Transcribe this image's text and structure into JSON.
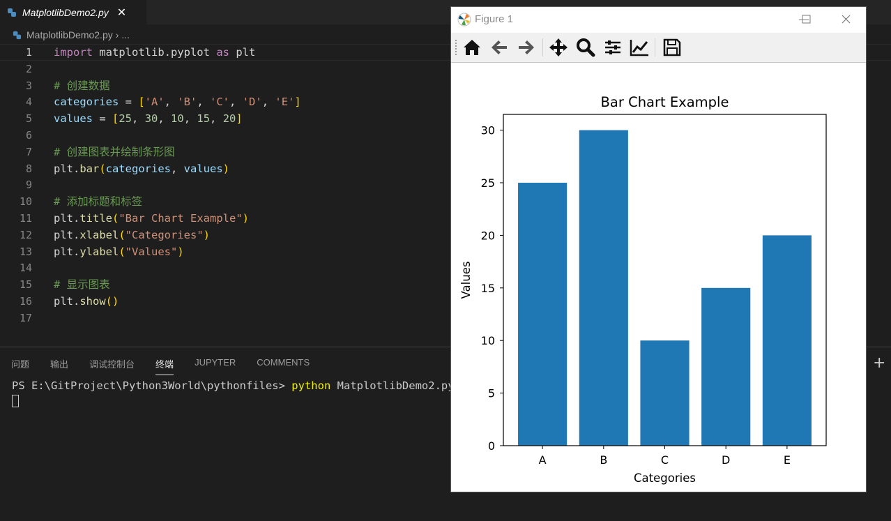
{
  "editor": {
    "tab": {
      "filename": "MatplotlibDemo2.py"
    },
    "breadcrumb": {
      "file": "MatplotlibDemo2.py",
      "sep": "›",
      "rest": "..."
    },
    "line_numbers": [
      "1",
      "2",
      "3",
      "4",
      "5",
      "6",
      "7",
      "8",
      "9",
      "10",
      "11",
      "12",
      "13",
      "14",
      "15",
      "16",
      "17"
    ],
    "lines": [
      [
        {
          "t": "import",
          "c": "kw"
        },
        {
          "t": " matplotlib.pyplot ",
          "c": "plain"
        },
        {
          "t": "as",
          "c": "kw"
        },
        {
          "t": " plt",
          "c": "plain"
        }
      ],
      [],
      [
        {
          "t": "# 创建数据",
          "c": "cmt"
        }
      ],
      [
        {
          "t": "categories",
          "c": "var"
        },
        {
          "t": " = ",
          "c": "plain"
        },
        {
          "t": "[",
          "c": "br1"
        },
        {
          "t": "'A'",
          "c": "str"
        },
        {
          "t": ", ",
          "c": "plain"
        },
        {
          "t": "'B'",
          "c": "str"
        },
        {
          "t": ", ",
          "c": "plain"
        },
        {
          "t": "'C'",
          "c": "str"
        },
        {
          "t": ", ",
          "c": "plain"
        },
        {
          "t": "'D'",
          "c": "str"
        },
        {
          "t": ", ",
          "c": "plain"
        },
        {
          "t": "'E'",
          "c": "str"
        },
        {
          "t": "]",
          "c": "br1"
        }
      ],
      [
        {
          "t": "values",
          "c": "var"
        },
        {
          "t": " = ",
          "c": "plain"
        },
        {
          "t": "[",
          "c": "br1"
        },
        {
          "t": "25",
          "c": "num"
        },
        {
          "t": ", ",
          "c": "plain"
        },
        {
          "t": "30",
          "c": "num"
        },
        {
          "t": ", ",
          "c": "plain"
        },
        {
          "t": "10",
          "c": "num"
        },
        {
          "t": ", ",
          "c": "plain"
        },
        {
          "t": "15",
          "c": "num"
        },
        {
          "t": ", ",
          "c": "plain"
        },
        {
          "t": "20",
          "c": "num"
        },
        {
          "t": "]",
          "c": "br1"
        }
      ],
      [],
      [
        {
          "t": "# 创建图表并绘制条形图",
          "c": "cmt"
        }
      ],
      [
        {
          "t": "plt.",
          "c": "plain"
        },
        {
          "t": "bar",
          "c": "fn"
        },
        {
          "t": "(",
          "c": "br1"
        },
        {
          "t": "categories",
          "c": "var"
        },
        {
          "t": ", ",
          "c": "plain"
        },
        {
          "t": "values",
          "c": "var"
        },
        {
          "t": ")",
          "c": "br1"
        }
      ],
      [],
      [
        {
          "t": "# 添加标题和标签",
          "c": "cmt"
        }
      ],
      [
        {
          "t": "plt.",
          "c": "plain"
        },
        {
          "t": "title",
          "c": "fn"
        },
        {
          "t": "(",
          "c": "br1"
        },
        {
          "t": "\"Bar Chart Example\"",
          "c": "str"
        },
        {
          "t": ")",
          "c": "br1"
        }
      ],
      [
        {
          "t": "plt.",
          "c": "plain"
        },
        {
          "t": "xlabel",
          "c": "fn"
        },
        {
          "t": "(",
          "c": "br1"
        },
        {
          "t": "\"Categories\"",
          "c": "str"
        },
        {
          "t": ")",
          "c": "br1"
        }
      ],
      [
        {
          "t": "plt.",
          "c": "plain"
        },
        {
          "t": "ylabel",
          "c": "fn"
        },
        {
          "t": "(",
          "c": "br1"
        },
        {
          "t": "\"Values\"",
          "c": "str"
        },
        {
          "t": ")",
          "c": "br1"
        }
      ],
      [],
      [
        {
          "t": "# 显示图表",
          "c": "cmt"
        }
      ],
      [
        {
          "t": "plt.",
          "c": "plain"
        },
        {
          "t": "show",
          "c": "fn"
        },
        {
          "t": "()",
          "c": "br1"
        }
      ],
      []
    ],
    "current_line": 1
  },
  "panel": {
    "tabs": [
      "问题",
      "输出",
      "调试控制台",
      "终端",
      "JUPYTER",
      "COMMENTS"
    ],
    "active_tab": "终端",
    "terminal": {
      "prompt": "PS E:\\GitProject\\Python3World\\pythonfiles> ",
      "command": "python",
      "args": " MatplotlibDemo2.py"
    }
  },
  "figure_window": {
    "title": "Figure 1",
    "toolbar_icons": [
      "home-icon",
      "back-arrow-icon",
      "forward-arrow-icon",
      "pan-icon",
      "zoom-icon",
      "configure-subplots-icon",
      "edit-axis-icon",
      "save-icon"
    ]
  },
  "colors": {
    "bar": "#1f77b4",
    "editor_bg": "#1e1e1e"
  },
  "chart_data": {
    "type": "bar",
    "title": "Bar Chart Example",
    "xlabel": "Categories",
    "ylabel": "Values",
    "categories": [
      "A",
      "B",
      "C",
      "D",
      "E"
    ],
    "values": [
      25,
      30,
      10,
      15,
      20
    ],
    "ylim": [
      0,
      31.5
    ],
    "yticks": [
      0,
      5,
      10,
      15,
      20,
      25,
      30
    ],
    "grid": false
  }
}
